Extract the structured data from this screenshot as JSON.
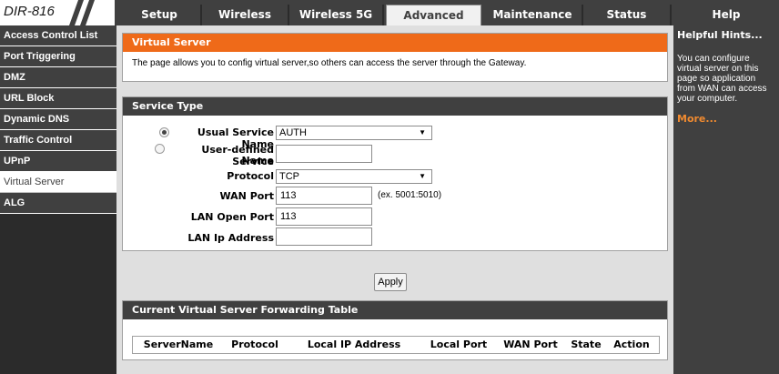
{
  "brand": "DIR-816",
  "tabs": [
    {
      "label": "Setup",
      "active": false
    },
    {
      "label": "Wireless",
      "active": false
    },
    {
      "label": "Wireless 5G",
      "active": false
    },
    {
      "label": "Advanced",
      "active": true
    },
    {
      "label": "Maintenance",
      "active": false
    },
    {
      "label": "Status",
      "active": false
    },
    {
      "label": "Help",
      "active": false
    }
  ],
  "sidebar": {
    "items": [
      {
        "label": "Access Control List"
      },
      {
        "label": "Port Triggering"
      },
      {
        "label": "DMZ"
      },
      {
        "label": "URL Block"
      },
      {
        "label": "Dynamic DNS"
      },
      {
        "label": "Traffic Control"
      },
      {
        "label": "UPnP"
      },
      {
        "label": "Virtual Server",
        "active": true
      },
      {
        "label": "ALG"
      }
    ]
  },
  "virtual_server": {
    "title": "Virtual Server",
    "description": "The page allows you to config virtual server,so others can access the server through the Gateway."
  },
  "service_type": {
    "title": "Service Type",
    "usual_service_label": "Usual Service Name",
    "usual_service_value": "AUTH",
    "user_defined_label_1": "User-defined Service",
    "user_defined_label_2": "Name",
    "user_defined_value": "",
    "protocol_label": "Protocol",
    "protocol_value": "TCP",
    "wan_port_label": "WAN Port",
    "wan_port_value": "113",
    "wan_port_hint": "(ex. 5001:5010)",
    "lan_open_port_label": "LAN Open Port",
    "lan_open_port_value": "113",
    "lan_ip_label": "LAN Ip Address",
    "lan_ip_value": ""
  },
  "apply_label": "Apply",
  "forwarding_table": {
    "title": "Current Virtual Server Forwarding Table",
    "columns": [
      "ServerName",
      "Protocol",
      "Local IP Address",
      "Local Port",
      "WAN Port",
      "State",
      "Action"
    ]
  },
  "help": {
    "title": "Helpful Hints...",
    "text": "You can configure virtual server on this page so application from WAN can access your computer.",
    "more": "More..."
  },
  "colors": {
    "accent_orange": "#ef6a19",
    "bar_dark": "#404040",
    "panel_gray": "#dfdfdf"
  }
}
